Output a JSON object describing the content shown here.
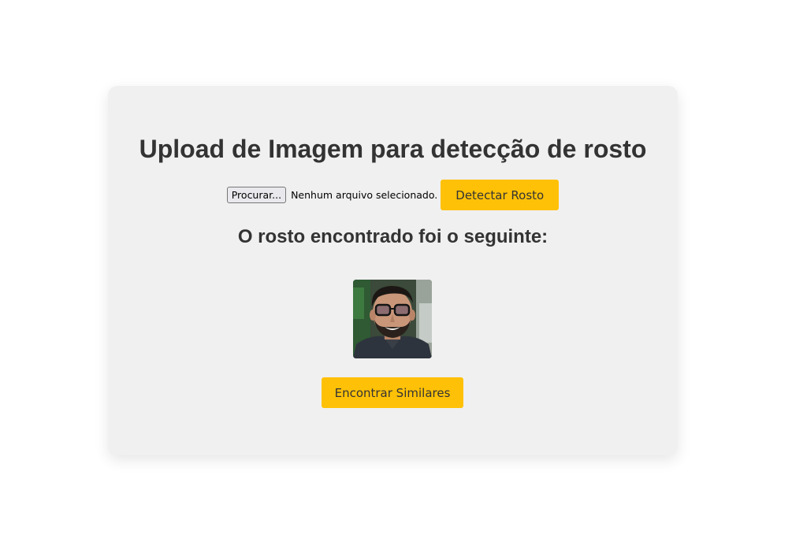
{
  "title": "Upload de Imagem para detecção de rosto",
  "upload": {
    "browse_label": "Procurar...",
    "file_status": "Nenhum arquivo selecionado.",
    "detect_label": "Detectar Rosto"
  },
  "result": {
    "heading": "O rosto encontrado foi o seguinte:",
    "find_similar_label": "Encontrar Similares"
  },
  "colors": {
    "accent": "#ffc107",
    "card_bg": "#f0f0f0",
    "text": "#333333"
  }
}
